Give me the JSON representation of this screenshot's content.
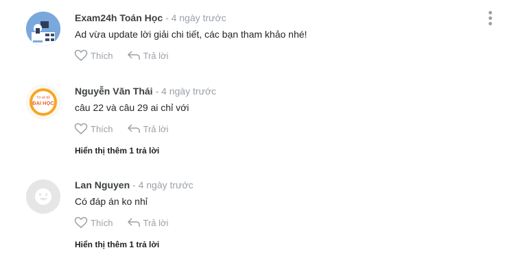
{
  "comments": [
    {
      "author": "Exam24h Toán Học",
      "separator": "-",
      "time": "4 ngày trước",
      "text": "Ad vừa update lời giải chi tiết, các bạn tham khảo nhé!",
      "like_label": "Thích",
      "reply_label": "Trả lời",
      "avatar_icon": "exam-bot-avatar-icon",
      "avatar_colors": [
        "#6e9fd6",
        "#ffffff"
      ]
    },
    {
      "author": "Nguyễn Văn Thái",
      "separator": "-",
      "time": "4 ngày trước",
      "text": "câu 22 và câu 29 ai chỉ với",
      "like_label": "Thích",
      "reply_label": "Trả lời",
      "more_replies": "Hiển thị thêm 1 trả lời",
      "avatar_icon": "dai-hoc-badge-icon",
      "avatar_badge_top": "Tớ sẽ đỗ",
      "avatar_badge_main": "ĐẠI HỌC",
      "avatar_colors": [
        "#f5a623",
        "#e85d2a"
      ]
    },
    {
      "author": "Lan Nguyen",
      "separator": "-",
      "time": "4 ngày trước",
      "text": "Có đáp án ko nhỉ",
      "like_label": "Thích",
      "reply_label": "Trả lời",
      "more_replies": "Hiển thị thêm 1 trả lời",
      "avatar_icon": "default-smiley-avatar-icon",
      "avatar_colors": [
        "#e6e6e6",
        "#ffffff"
      ]
    }
  ],
  "menu_icon": "kebab-menu-icon"
}
